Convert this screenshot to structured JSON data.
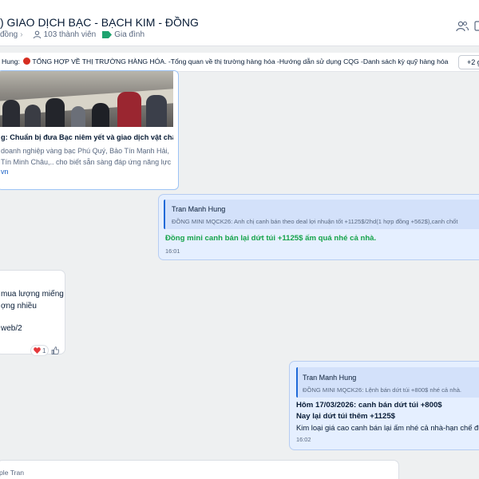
{
  "header": {
    "title": ") GIAO DỊCH BẠC - BẠCH KIM - ĐỒNG",
    "community_label": "đồng",
    "members": "103 thành viên",
    "tag": "Gia đình",
    "tag_color": "#1ea36f"
  },
  "pinned": {
    "author": "Hung:",
    "text": "TỔNG HỢP VỀ THỊ TRƯỜNG HÀNG HÓA. -Tổng quan về thị trường hàng hóa -Hướng dẫn sử dụng CQG -Danh sách kỳ quỹ hàng hóa -Phân tíc...",
    "more": "+2 g"
  },
  "link_card": {
    "title": "g: Chuẩn bị đưa Bạc niêm yết và giao dịch vật chất,...",
    "desc_lines": [
      "doanh nghiệp vàng bạc Phú Quý, Bảo Tín Mạnh Hải,",
      "Tín Minh Châu,.. cho biết sẵn sàng đáp ứng năng lực..."
    ],
    "site": "vn"
  },
  "msg1": {
    "quote_name": "Tran Manh Hung",
    "quote_text": "ĐỒNG MINI MQCK26: Anh chị canh bán theo deal lợi nhuận tốt +1125$/2hd(1 hợp đồng +562$),canh chốt",
    "text": "Đồng mini canh bán lại dứt túi +1125$ ấm quá nhé cả nhà.",
    "time": "16:01",
    "text_color": "#15a34a"
  },
  "msg_in": {
    "lines": [
      "mua lượng miếng",
      "ợng nhiều",
      "web/2"
    ],
    "reaction_count": "1"
  },
  "msg2": {
    "quote_name": "Tran Manh Hung",
    "quote_text": "ĐỒNG MINI MQCK26: Lệnh bán dứt túi +800$ nhé cả nhà.",
    "line1": "Hôm 17/03/2026: canh bán dứt túi +800$",
    "line2": "Nay lại dứt túi thêm +1125$",
    "line3": "Kim loại giá cao canh bán lại ấm nhé cả nhà-hạn chế đu",
    "time": "16:02"
  },
  "msg_bottom": {
    "name": "ple Tran"
  },
  "icons": {
    "members": "person-icon",
    "tag": "tag-icon",
    "header_right_1": "group-add-icon",
    "header_right_2": "layout-icon",
    "pinned_dot": "red-circle-emoji",
    "reaction_heart": "heart-icon",
    "reaction_like": "thumbs-up-icon"
  }
}
